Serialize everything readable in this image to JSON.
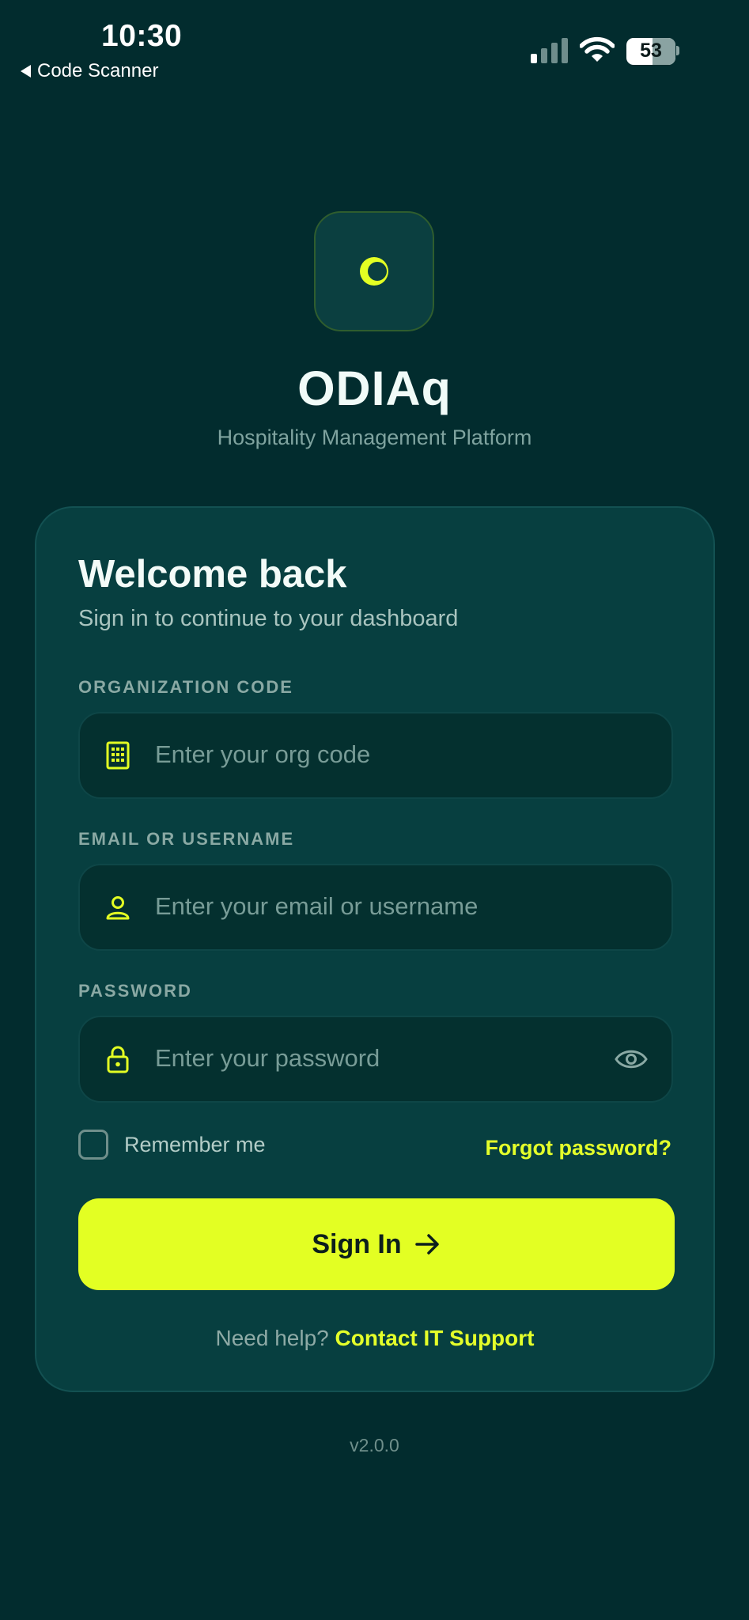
{
  "status_bar": {
    "time": "10:30",
    "back_app": "Code Scanner",
    "battery": "53",
    "icons": [
      "cellular-signal-icon",
      "wifi-icon",
      "battery-icon"
    ]
  },
  "brand": {
    "logo_icon": "crescent-logo-icon",
    "name": "ODIAq",
    "tagline": "Hospitality Management Platform"
  },
  "card": {
    "title": "Welcome back",
    "subtitle": "Sign in to continue to your dashboard",
    "fields": [
      {
        "label": "ORGANIZATION CODE",
        "placeholder": "Enter your org code",
        "icon": "building-icon"
      },
      {
        "label": "EMAIL OR USERNAME",
        "placeholder": "Enter your email or username",
        "icon": "user-icon"
      },
      {
        "label": "PASSWORD",
        "placeholder": "Enter your password",
        "icon": "lock-icon",
        "toggle_icon": "eye-icon"
      }
    ],
    "remember_label": "Remember me",
    "forgot_label": "Forgot password?",
    "signin_label": "Sign In",
    "help_prefix": "Need help?",
    "help_link": "Contact IT Support"
  },
  "version": "v2.0.0",
  "colors": {
    "background": "#022c2e",
    "card": "#073f40",
    "accent": "#e3ff23",
    "muted_text": "#8eaaa6"
  }
}
